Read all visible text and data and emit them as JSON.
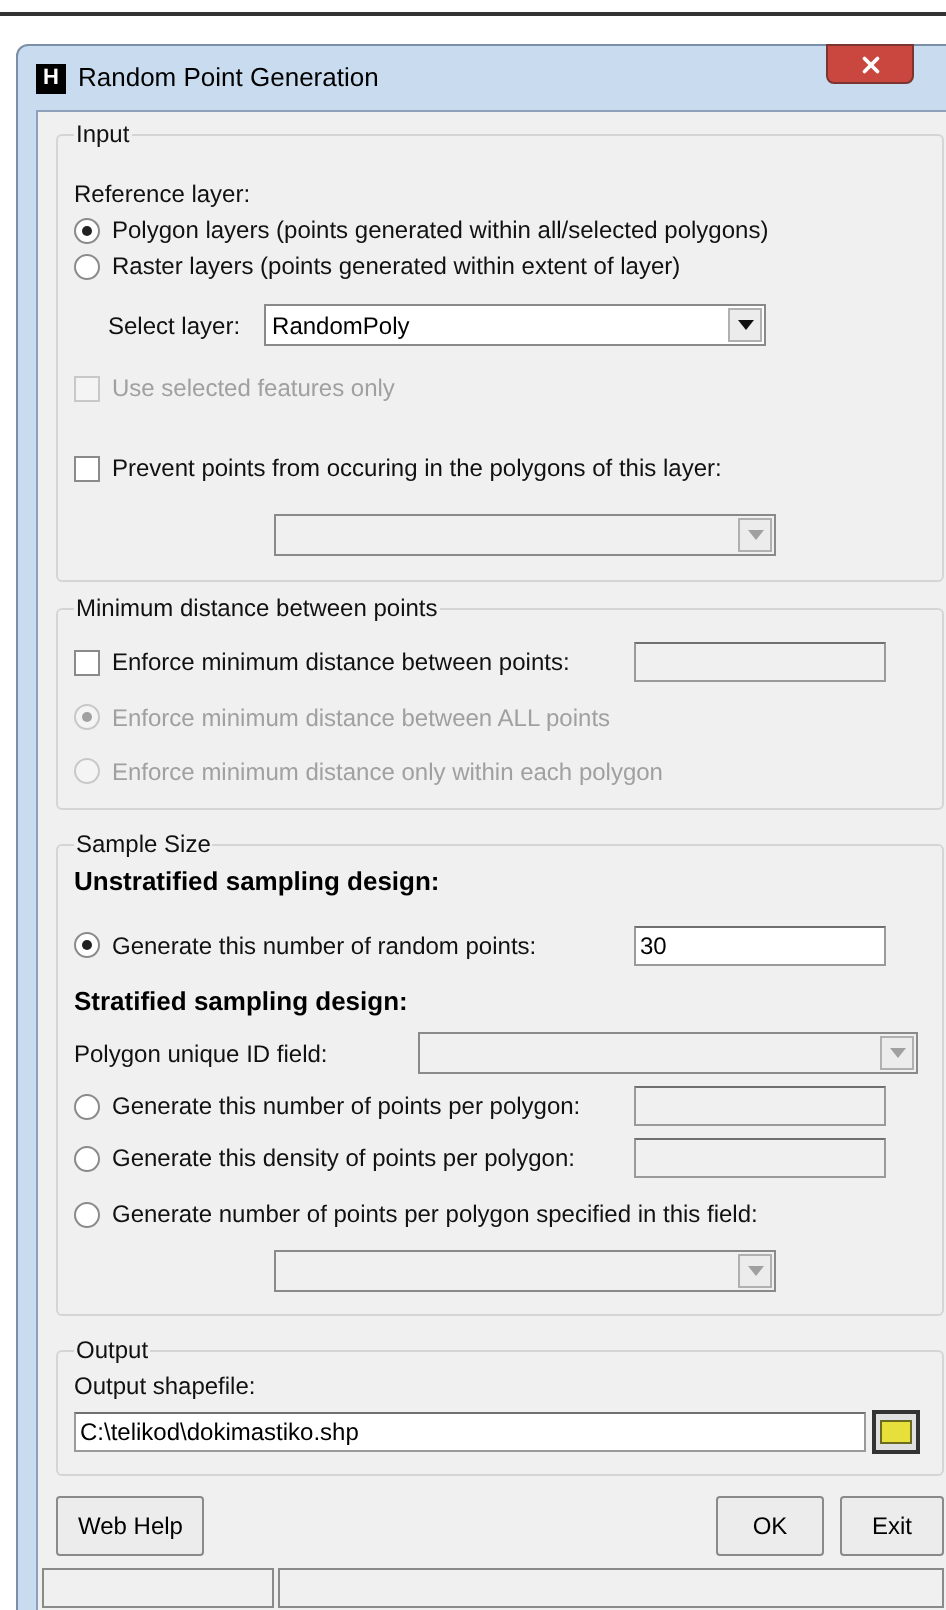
{
  "window": {
    "title": "Random Point Generation",
    "icon_letter": "H"
  },
  "input": {
    "title": "Input",
    "reference_label": "Reference layer:",
    "reference_options": [
      {
        "label": "Polygon layers (points generated within all/selected polygons)",
        "selected": true
      },
      {
        "label": "Raster layers (points generated within extent of layer)",
        "selected": false
      }
    ],
    "select_layer": {
      "label": "Select layer:",
      "value": "RandomPoly",
      "disabled": false
    },
    "use_selected": {
      "label": "Use selected features only",
      "checked": false,
      "disabled": true
    },
    "prevent": {
      "label": "Prevent points from occuring in the polygons of this layer:",
      "checked": false,
      "disabled": false
    },
    "prevent_layer": {
      "disabled": true
    }
  },
  "min_distance": {
    "title": "Minimum distance between points",
    "enforce": {
      "label": "Enforce minimum distance between points:",
      "checked": false,
      "disabled": false
    },
    "distance_field": {
      "disabled": true
    },
    "options": [
      {
        "label": "Enforce minimum distance between ALL points",
        "selected": true,
        "disabled": true
      },
      {
        "label": "Enforce minimum distance only within each polygon",
        "selected": false,
        "disabled": true
      }
    ]
  },
  "sample_size": {
    "title": "Sample Size",
    "rows": [
      {
        "kind": "heading",
        "text": "Unstratified sampling design:"
      },
      {
        "kind": "radio-input",
        "label": "Generate this number of random points:",
        "selected": true,
        "value": "30",
        "disabled": false
      },
      {
        "kind": "heading",
        "text": "Stratified sampling design:"
      },
      {
        "kind": "select",
        "label": "Polygon unique ID field:",
        "disabled": true
      },
      {
        "kind": "radio-input",
        "label": "Generate this number of points per polygon:",
        "selected": false,
        "disabled": true
      },
      {
        "kind": "radio-input",
        "label": "Generate this density of points per polygon:",
        "selected": false,
        "disabled": true
      },
      {
        "kind": "radio-dropdown",
        "label": "Generate number of points per polygon specified in this field:",
        "selected": false,
        "disabled": true
      }
    ]
  },
  "output": {
    "title": "Output",
    "label": "Output shapefile:",
    "value": "C:\\telikod\\dokimastiko.shp"
  },
  "buttons": {
    "help": "Web Help",
    "ok": "OK",
    "exit": "Exit"
  }
}
